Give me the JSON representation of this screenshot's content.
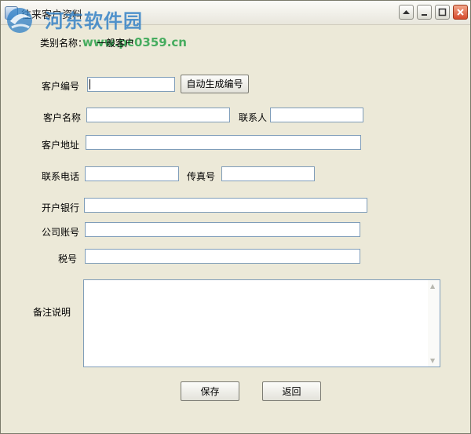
{
  "window": {
    "title": "往来客户资料"
  },
  "watermark": {
    "site": "河东软件园",
    "url": "www.pc0359.cn"
  },
  "category": {
    "label": "类别名称：",
    "value": "一般客户"
  },
  "form": {
    "customer_code": {
      "label": "客户编号",
      "value": "",
      "button": "自动生成编号"
    },
    "customer_name": {
      "label": "客户名称",
      "value": ""
    },
    "contact_person": {
      "label": "联系人",
      "value": ""
    },
    "address": {
      "label": "客户地址",
      "value": ""
    },
    "phone": {
      "label": "联系电话",
      "value": ""
    },
    "fax": {
      "label": "传真号",
      "value": ""
    },
    "bank": {
      "label": "开户银行",
      "value": ""
    },
    "account": {
      "label": "公司账号",
      "value": ""
    },
    "tax_no": {
      "label": "税号",
      "value": ""
    },
    "remarks": {
      "label": "备注说明",
      "value": ""
    }
  },
  "buttons": {
    "save": "保存",
    "back": "返回"
  },
  "icons": {
    "app": "window-icon",
    "help": "arrow-up-icon",
    "minimize": "minimize-icon",
    "maximize": "maximize-icon",
    "close": "close-icon"
  },
  "colors": {
    "window_bg": "#ece9d8",
    "input_border": "#7f9db9",
    "close_button": "#d6492a",
    "watermark_blue": "#2f7fc6",
    "watermark_green": "#2aa24a"
  }
}
